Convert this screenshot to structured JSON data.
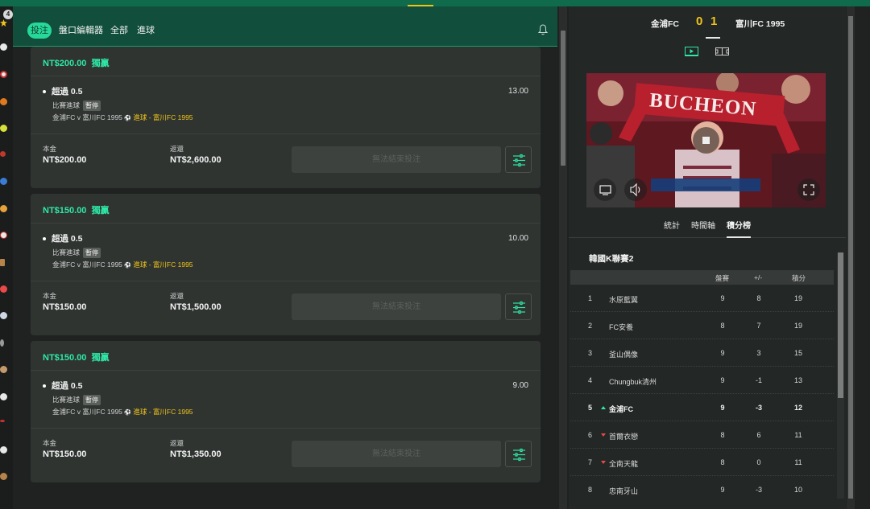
{
  "sidebar": {
    "badge_count": "4"
  },
  "bet_header": {
    "tabs": [
      {
        "label": "投注",
        "active": true
      },
      {
        "label": "盤口編輯器"
      },
      {
        "label": "全部"
      },
      {
        "label": "進球"
      }
    ]
  },
  "bets": [
    {
      "stake_header": "NT$200.00",
      "bet_type": "獨贏",
      "selection": "超過 0.5",
      "odds": "13.00",
      "market": "比賽進球",
      "status": "暫停",
      "match": "金浦FC v 富川FC 1995",
      "event": "進球 - 富川FC 1995",
      "stake_label": "本金",
      "stake_value": "NT$200.00",
      "return_label": "返還",
      "return_value": "NT$2,600.00",
      "cashout_label": "無法結束投注"
    },
    {
      "stake_header": "NT$150.00",
      "bet_type": "獨贏",
      "selection": "超過 0.5",
      "odds": "10.00",
      "market": "比賽進球",
      "status": "暫停",
      "match": "金浦FC v 富川FC 1995",
      "event": "進球 - 富川FC 1995",
      "stake_label": "本金",
      "stake_value": "NT$150.00",
      "return_label": "返還",
      "return_value": "NT$1,500.00",
      "cashout_label": "無法結束投注"
    },
    {
      "stake_header": "NT$150.00",
      "bet_type": "獨贏",
      "selection": "超過 0.5",
      "odds": "9.00",
      "market": "比賽進球",
      "status": "暫停",
      "match": "金浦FC v 富川FC 1995",
      "event": "進球 - 富川FC 1995",
      "stake_label": "本金",
      "stake_value": "NT$150.00",
      "return_label": "返還",
      "return_value": "NT$1,350.00",
      "cashout_label": "無法結束投注"
    }
  ],
  "scoreboard": {
    "home": "金浦FC",
    "home_score": "0",
    "away_score": "1",
    "away": "富川FC 1995"
  },
  "video": {
    "banner_text": "BUCHEON"
  },
  "match_tabs": [
    "統計",
    "時間軸",
    "積分榜"
  ],
  "standings": {
    "league": "韓國K聯賽2",
    "columns": [
      "",
      "",
      "盤賽",
      "+/-",
      "積分"
    ],
    "rows": [
      {
        "rank": "1",
        "team": "水原藍翼",
        "played": "9",
        "gd": "8",
        "pts": "19"
      },
      {
        "rank": "2",
        "team": "FC安養",
        "played": "8",
        "gd": "7",
        "pts": "19"
      },
      {
        "rank": "3",
        "team": "釜山偶像",
        "played": "9",
        "gd": "3",
        "pts": "15"
      },
      {
        "rank": "4",
        "team": "Chungbuk清州",
        "played": "9",
        "gd": "-1",
        "pts": "13"
      },
      {
        "rank": "5",
        "team": "金浦FC",
        "played": "9",
        "gd": "-3",
        "pts": "12",
        "trend": "up"
      },
      {
        "rank": "6",
        "team": "首爾衣戀",
        "played": "8",
        "gd": "6",
        "pts": "11",
        "trend": "down"
      },
      {
        "rank": "7",
        "team": "全南天龍",
        "played": "8",
        "gd": "0",
        "pts": "11",
        "trend": "down"
      },
      {
        "rank": "8",
        "team": "忠南牙山",
        "played": "9",
        "gd": "-3",
        "pts": "10"
      }
    ]
  },
  "colors": {
    "accent": "#2fe8a7",
    "highlight": "#f0c419",
    "header": "#114f3c"
  }
}
